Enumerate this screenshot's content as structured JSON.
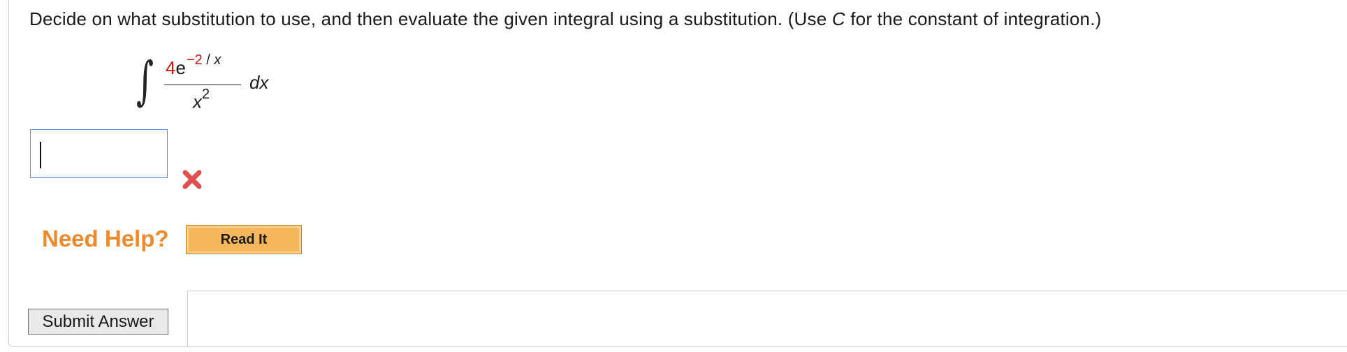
{
  "question": {
    "text_before": "Decide on what substitution to use, and then evaluate the given integral using a substitution. (Use ",
    "constant_var": "C",
    "text_after": " for the constant of integration.)"
  },
  "integral": {
    "sign": "∫",
    "coefficient": "4",
    "base": "e",
    "exponent_value": "−2",
    "exponent_slash": " / ",
    "exponent_var": "x",
    "denominator_var": "x",
    "denominator_power": "2",
    "differential": "dx"
  },
  "answer": {
    "value": "",
    "status": "incorrect",
    "status_color": "#e05050"
  },
  "help": {
    "label": "Need Help?",
    "read_it_label": "Read It",
    "label_color": "#ee8a2c"
  },
  "submit": {
    "label": "Submit Answer"
  }
}
